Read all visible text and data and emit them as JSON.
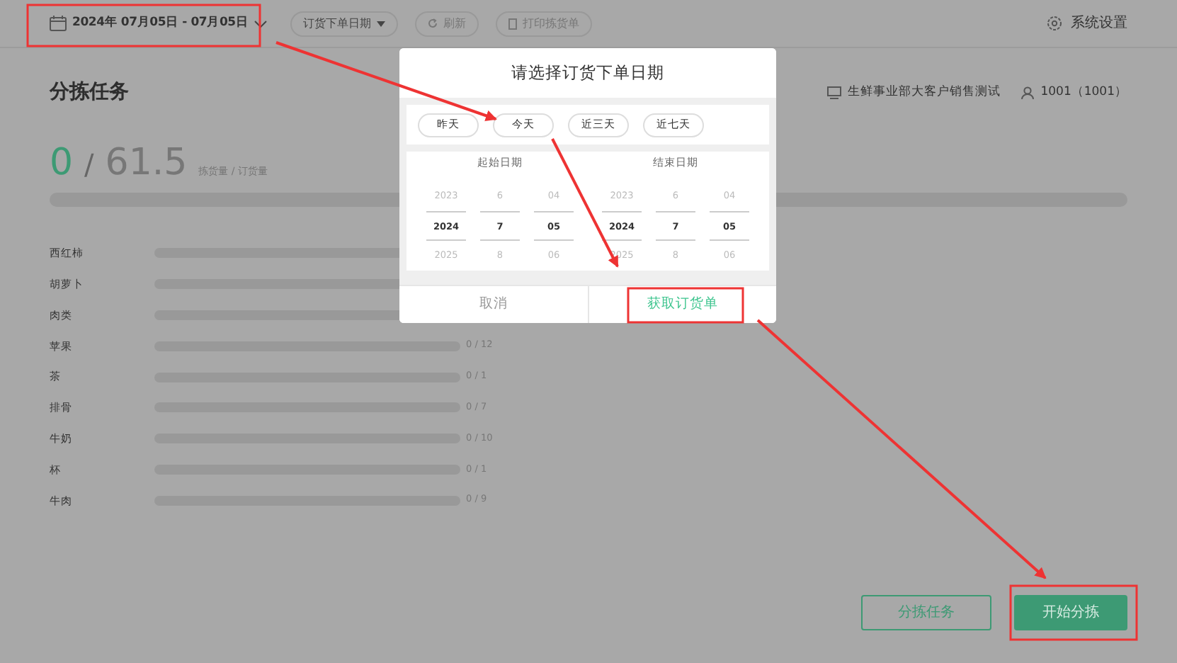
{
  "topbar": {
    "date_range": "2024年 07月05日 - 07月05日",
    "date_type": "订货下单日期",
    "refresh": "刷新",
    "print": "打印拣货单",
    "settings": "系统设置"
  },
  "header": {
    "title": "分拣任务",
    "store": "生鲜事业部大客户销售测试",
    "user": "1001（1001）"
  },
  "summary": {
    "picked": "0",
    "separator": "/",
    "ordered": "61.5",
    "caption": "拣货量 / 订货量",
    "level": 0
  },
  "items": [
    {
      "name": "西红柿",
      "level": 0
    },
    {
      "name": "胡萝卜",
      "level": 0
    },
    {
      "name": "肉类",
      "level": 0
    },
    {
      "name": "苹果",
      "level": 0,
      "count": "0 / 12"
    },
    {
      "name": "茶",
      "level": 0,
      "count": "0 / 1"
    },
    {
      "name": "排骨",
      "level": 0,
      "count": "0 / 7"
    },
    {
      "name": "牛奶",
      "level": 0,
      "count": "0 / 10"
    },
    {
      "name": "杯",
      "level": 0,
      "count": "0 / 1"
    },
    {
      "name": "牛肉",
      "level": 0,
      "count": "0 / 9"
    }
  ],
  "buttons": [
    {
      "label": "分拣任务",
      "kind": "outline"
    },
    {
      "label": "开始分拣",
      "kind": "primary"
    }
  ],
  "dialog": {
    "title": "请选择订货下单日期",
    "quick": [
      {
        "label": "昨天"
      },
      {
        "label": "今天"
      },
      {
        "label": "近三天"
      },
      {
        "label": "近七天"
      }
    ],
    "pickers": [
      {
        "label": "起始日期",
        "columns": [
          {
            "items": [
              {
                "text": "2023",
                "selected": false
              },
              {
                "text": "2024",
                "selected": true
              },
              {
                "text": "2025",
                "selected": false
              }
            ]
          },
          {
            "items": [
              {
                "text": "6",
                "selected": false
              },
              {
                "text": "7",
                "selected": true
              },
              {
                "text": "8",
                "selected": false
              }
            ]
          },
          {
            "items": [
              {
                "text": "04",
                "selected": false
              },
              {
                "text": "05",
                "selected": true
              },
              {
                "text": "06",
                "selected": false
              }
            ]
          }
        ]
      },
      {
        "label": "结束日期",
        "columns": [
          {
            "items": [
              {
                "text": "2023",
                "selected": false
              },
              {
                "text": "2024",
                "selected": true
              },
              {
                "text": "2025",
                "selected": false
              }
            ]
          },
          {
            "items": [
              {
                "text": "6",
                "selected": false
              },
              {
                "text": "7",
                "selected": true
              },
              {
                "text": "8",
                "selected": false
              }
            ]
          },
          {
            "items": [
              {
                "text": "04",
                "selected": false
              },
              {
                "text": "05",
                "selected": true
              },
              {
                "text": "06",
                "selected": false
              }
            ]
          }
        ]
      }
    ],
    "cancel": "取消",
    "confirm": "获取订货单"
  }
}
